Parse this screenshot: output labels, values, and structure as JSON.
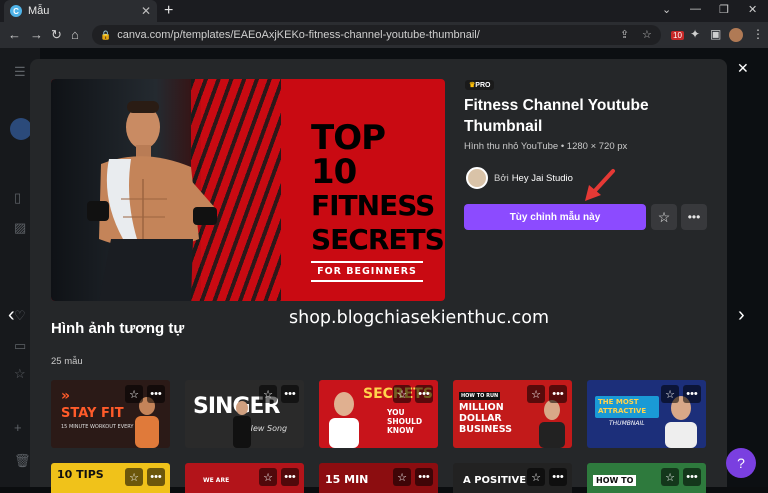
{
  "browser": {
    "tab_title": "Mẫu",
    "new_tab": "+",
    "url": "canva.com/p/templates/EAEoAxjKEKo-fitness-channel-youtube-thumbnail/",
    "extension_badge": "10"
  },
  "template": {
    "badge": "PRO",
    "title": "Fitness Channel Youtube Thumbnail",
    "meta": "Hình thu nhỏ YouTube • 1280 × 720 px",
    "author_prefix": "Bởi",
    "author_name": "Hey Jai Studio",
    "cta_label": "Tùy chỉnh mẫu này",
    "hero": {
      "line1": "TOP 10",
      "line2": "FITNESS",
      "line3": "SECRETS",
      "subtitle": "FOR BEGINNERS"
    }
  },
  "similar": {
    "heading": "Hình ảnh tương tự",
    "count": "25 mẫu",
    "cards": [
      {
        "text": "STAY FIT",
        "sub": "15 MINUTE WORKOUT EVERY DAY",
        "bg": "#2b1a17",
        "accent": "#ff5b2a"
      },
      {
        "text": "SINGER",
        "sub": "New Song",
        "bg": "#2a2a2a",
        "accent": "#ffffff"
      },
      {
        "text": "SECRETS",
        "sub": "YOU SHOULD KNOW",
        "bg": "#c8141b",
        "accent": "#ffd34d"
      },
      {
        "text": "MILLION DOLLAR BUSINESS",
        "sub": "HOW TO RUN",
        "bg": "#c21a1a",
        "accent": "#ffffff"
      },
      {
        "text": "THE MOST ATTRACTIVE",
        "sub": "THUMBNAIL",
        "bg": "#1c2f7a",
        "accent": "#ffd34d"
      }
    ],
    "row2": [
      {
        "text": "10 TIPS",
        "bg": "#f0c21a"
      },
      {
        "text": "WE ARE",
        "bg": "#b3141a"
      },
      {
        "text": "15 MIN",
        "bg": "#8c0d10"
      },
      {
        "text": "A POSITIVE",
        "bg": "#222222"
      },
      {
        "text": "HOW TO",
        "bg": "#2e7a3d"
      }
    ]
  },
  "watermark": "shop.blogchiasekienthuc.com",
  "colors": {
    "accent": "#8c4bff",
    "hero_red": "#c90a12"
  }
}
